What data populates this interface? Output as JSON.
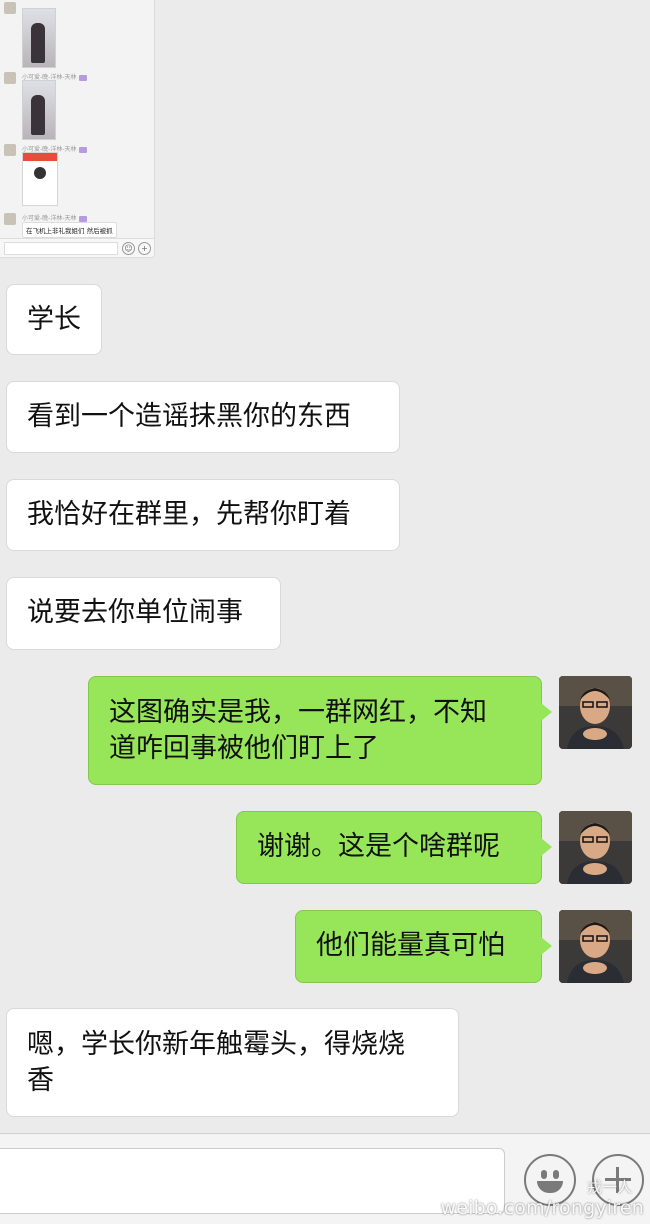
{
  "embedded_screenshot": {
    "nickname": "小可爱-晚-洋林-天林",
    "last_message": "在飞机上非礼我姐们 然后被抓"
  },
  "messages": [
    {
      "side": "in",
      "text": "学长"
    },
    {
      "side": "in",
      "text": "看到一个造谣抹黑你的东西"
    },
    {
      "side": "in",
      "text": "我恰好在群里，先帮你盯着"
    },
    {
      "side": "in",
      "text": "说要去你单位闹事"
    },
    {
      "side": "out",
      "line1": "这图确实是我，一群网红，不知",
      "line2": "道咋回事被他们盯上了"
    },
    {
      "side": "out",
      "text": "谢谢。这是个啥群呢"
    },
    {
      "side": "out",
      "text": "他们能量真可怕"
    },
    {
      "side": "in",
      "line1": "嗯，学长你新年触霉头，得烧烧",
      "line2": "香"
    }
  ],
  "input_bar": {
    "emoji_button": "emoji-icon",
    "plus_button": "plus-icon"
  },
  "watermark": {
    "handle": "weibo.com/rongyiren",
    "name": "戎一人"
  },
  "colors": {
    "background": "#ebebeb",
    "outgoing_bubble": "#97e65a",
    "incoming_bubble": "#ffffff"
  }
}
